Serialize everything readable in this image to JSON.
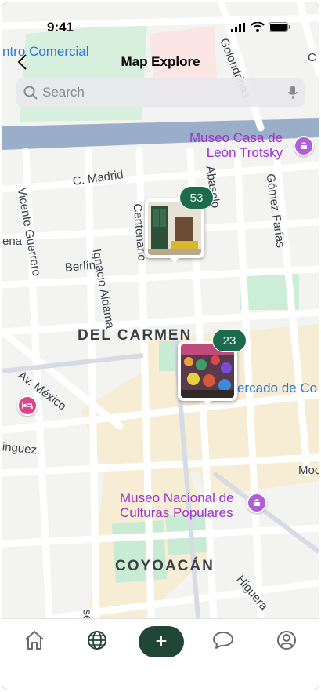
{
  "status_bar": {
    "time": "9:41"
  },
  "header": {
    "title": "Map Explore"
  },
  "search": {
    "placeholder": "Search"
  },
  "map": {
    "top_poi": "ntro Comercial",
    "labels": {
      "golondrinas": "Golondrinas",
      "c_cut": "C",
      "vicente_guerrero": "Vicente Guerrero",
      "c_madrid": "C. Madrid",
      "centenario": "Centenario",
      "abasolo": "Abasolo",
      "gomez_farias": "Gómez Farías",
      "ena": "ena",
      "berlin": "Berlín",
      "ignacio_aldama": "Ignacio Aldama",
      "av_mexico": "Av. México",
      "dominguez": "inguez",
      "moc": "Moc",
      "higuera": "Higuera",
      "ses": "ses"
    },
    "districts": {
      "del_carmen": "DEL CARMEN",
      "coyoacan": "COYOACÁN"
    },
    "pois": {
      "museo_casa": [
        "Museo Casa de",
        "León Trotsky"
      ],
      "mercado": "ercado de Co",
      "museo_nacional": [
        "Museo Nacional de",
        "Culturas Populares"
      ]
    },
    "pins": [
      {
        "count": "53",
        "photo": "interior room"
      },
      {
        "count": "23",
        "photo": "market stall"
      }
    ]
  },
  "tabbar": {
    "items": [
      {
        "icon": "home-icon"
      },
      {
        "icon": "globe-icon"
      },
      {
        "icon": "plus-icon",
        "label": "+"
      },
      {
        "icon": "chat-icon"
      },
      {
        "icon": "profile-icon"
      }
    ],
    "accent": "#1f4636"
  }
}
